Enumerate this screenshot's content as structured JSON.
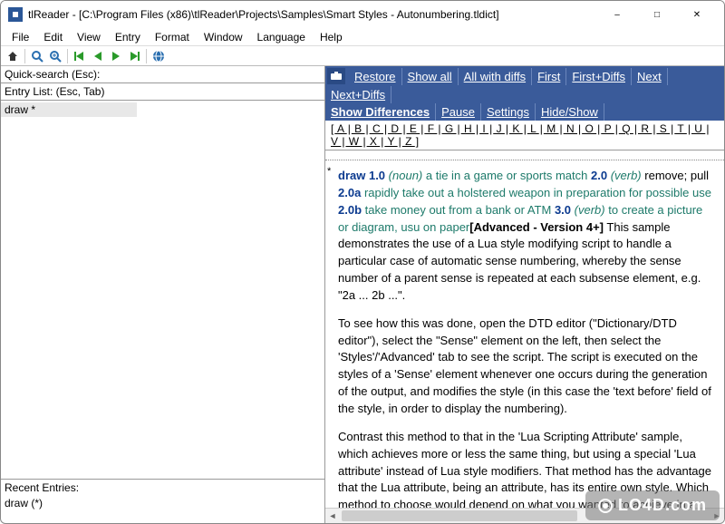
{
  "window": {
    "title": "tlReader - [C:\\Program Files (x86)\\tlReader\\Projects\\Samples\\Smart Styles - Autonumbering.tldict]"
  },
  "menu": [
    "File",
    "Edit",
    "View",
    "Entry",
    "Format",
    "Window",
    "Language",
    "Help"
  ],
  "quicksearch_label": "Quick-search (Esc):",
  "entrylist_label": "Entry List: (Esc, Tab)",
  "entrylist_items": [
    "draw   *"
  ],
  "recent_label": "Recent Entries:",
  "recent_items": [
    "draw (*)"
  ],
  "topnav_row1": [
    "Restore",
    "Show all",
    "All with diffs",
    "First",
    "First+Diffs",
    "Next",
    "Next+Diffs"
  ],
  "topnav_row2": [
    "Show Differences",
    "Pause",
    "Settings",
    "Hide/Show"
  ],
  "alphabet": [
    "A",
    "B",
    "C",
    "D",
    "E",
    "F",
    "G",
    "H",
    "I",
    "J",
    "K",
    "L",
    "M",
    "N",
    "O",
    "P",
    "Q",
    "R",
    "S",
    "T",
    "U",
    "V",
    "W",
    "X",
    "Y",
    "Z"
  ],
  "entry": {
    "headword": "draw",
    "s1num": "1.0",
    "s1pos": "(noun)",
    "s1def": "a tie in a game or sports match",
    "s2num": "2.0",
    "s2pos": "(verb)",
    "s2def": "remove; pull",
    "s2anum": "2.0a",
    "s2adef": "rapidly take out a holstered weapon in preparation for possible use",
    "s2bnum": "2.0b",
    "s2bdef": "take money out from a bank or ATM",
    "s3num": "3.0",
    "s3pos": "(verb)",
    "s3def": "to create a picture or diagram, usu on paper",
    "advanced": "[Advanced - Version 4+]",
    "desc": "This sample demonstrates the use of a Lua style modifying script to handle a particular case of automatic sense numbering, whereby the sense number of a parent sense is repeated at each subsense element, e.g. \"2a ... 2b ...\".",
    "p2": "To see how this was done, open the DTD editor (\"Dictionary/DTD editor\"), select the \"Sense\" element on the left, then select the 'Styles'/'Advanced' tab to see the script. The script is executed on the styles of a 'Sense' element whenever one occurs during the generation of the output, and modifies the style (in this case the 'text before' field of the style, in order to display the numbering).",
    "p3": "Contrast this method to that in the 'Lua Scripting Attribute' sample, which achieves more or less the same thing, but using a special 'Lua attribute' instead of Lua style modifiers. That method has the advantage that the Lua attribute, being an attribute, has its entire own style. Which method to choose would depend on what you wanted to achieve in a particular case."
  },
  "watermark": "LO4D.com"
}
